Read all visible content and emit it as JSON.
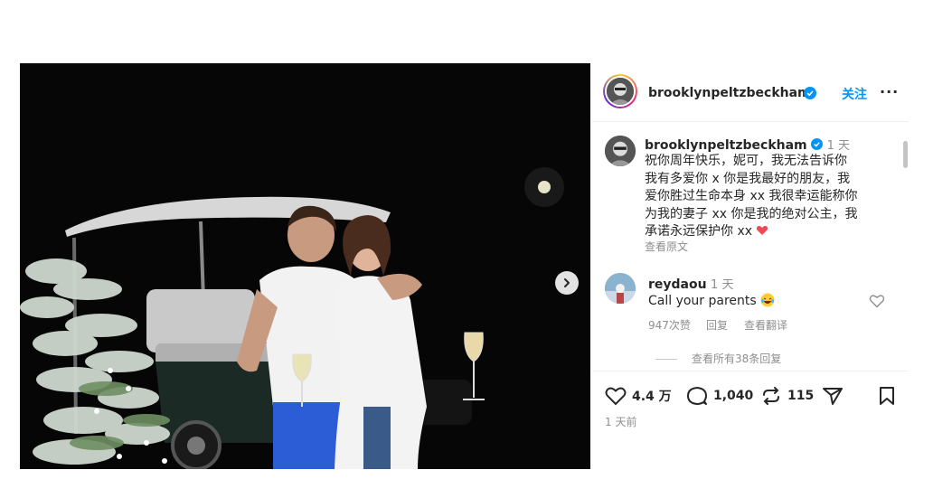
{
  "post": {
    "username": "brooklynpeltzbeckham",
    "follow_label": "关注",
    "more_label": "···"
  },
  "caption": {
    "username": "brooklynpeltzbeckham",
    "time": "1 天",
    "lines": [
      "祝你周年快乐，妮可，我无法告诉你",
      "我有多爱你 x 你是我最好的朋友，我",
      "爱你胜过生命本身 xx 我很幸运能称你",
      "为我的妻子 xx 你是我的绝对公主，我",
      "承诺永远保护你 xx"
    ],
    "see_original": "查看原文"
  },
  "comment": {
    "username": "reydaou",
    "time": "1 天",
    "text": "Call your parents",
    "likes": "947次赞",
    "reply_label": "回复",
    "translate_label": "查看翻译",
    "view_replies": "查看所有38条回复"
  },
  "actions": {
    "likes": "4.4 万",
    "comments": "1,040",
    "reposts": "115"
  },
  "posted_time": "1 天前",
  "colors": {
    "link": "#0095f6",
    "verified": "#0095f6",
    "heart": "#ed4956"
  },
  "icons": [
    "heart-icon",
    "comment-icon",
    "repost-icon",
    "share-icon",
    "bookmark-icon",
    "chevron-right-icon",
    "verified-icon",
    "more-icon"
  ]
}
